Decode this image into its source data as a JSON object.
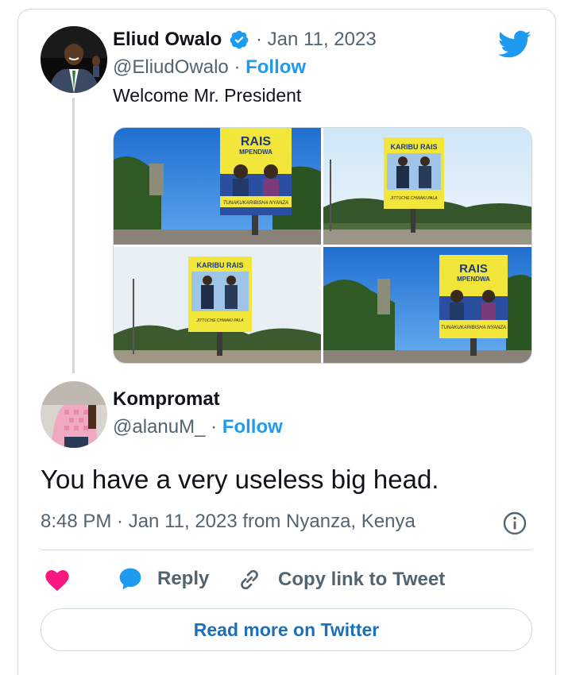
{
  "quoted_tweet": {
    "author_name": "Eliud Owalo",
    "date": "· Jan 11, 2023",
    "handle": "@EliudOwalo",
    "separator": "·",
    "follow_label": "Follow",
    "text": "Welcome Mr. President",
    "media": [
      {
        "headline": "RAIS",
        "subline": "MPENDWA",
        "caption": "TUNAKUKARIBISHA NYANZA"
      },
      {
        "headline": "KARIBU RAIS",
        "caption": "JITTUCHE CHWAKI PALA"
      },
      {
        "headline": "KARIBU RAIS",
        "caption": "JITTUCHE CHWAKI PALA"
      },
      {
        "headline": "RAIS",
        "subline": "MPENDWA",
        "caption": "TUNAKUKARIBISHA NYANZA"
      }
    ]
  },
  "reply_tweet": {
    "author_name": "Kompromat",
    "handle": "@alanuM_",
    "separator": "·",
    "follow_label": "Follow",
    "text": "You have a very useless big head.",
    "timestamp": "8:48 PM · Jan 11, 2023 from Nyanza, Kenya"
  },
  "actions": {
    "like_icon": "heart-icon",
    "reply_label": "Reply",
    "copy_label": "Copy link to Tweet"
  },
  "read_more_label": "Read more on Twitter",
  "colors": {
    "twitter_blue": "#1d9bf0",
    "heart": "#f91880",
    "muted_text": "#536471",
    "border": "#cfd9de"
  }
}
